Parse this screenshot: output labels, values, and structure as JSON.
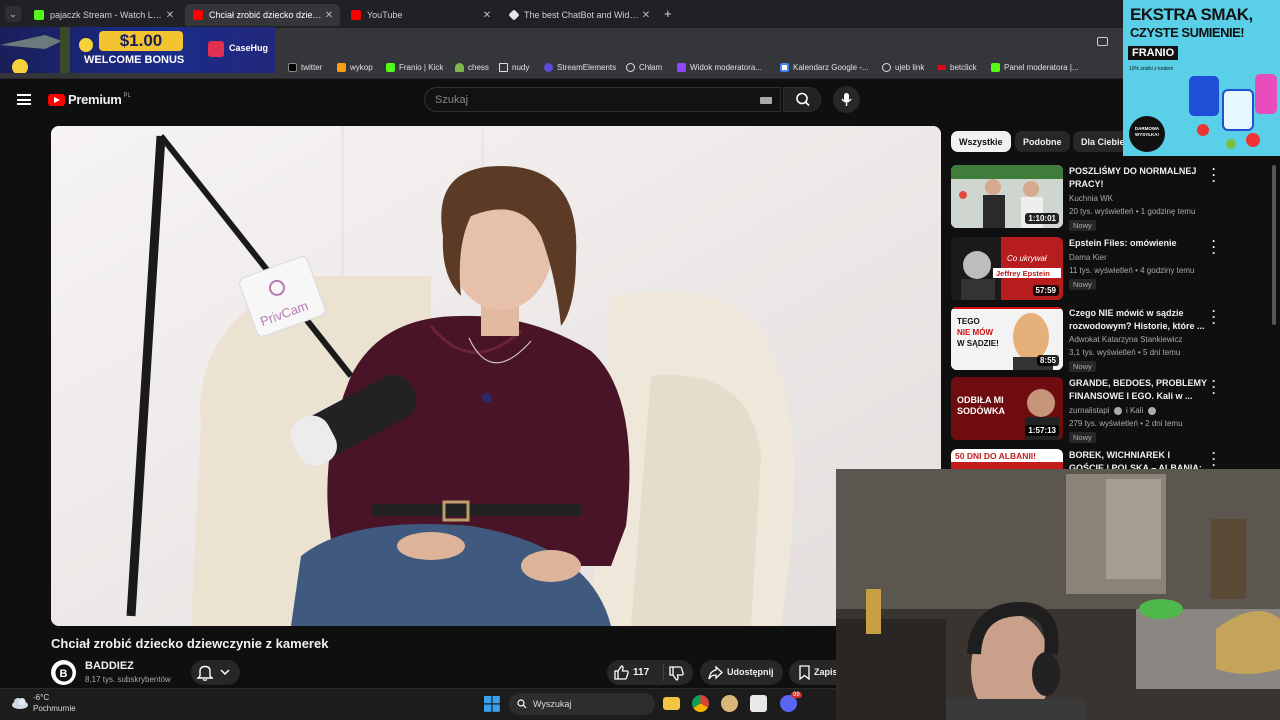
{
  "browser": {
    "tabs": [
      {
        "title": "pajaczk Stream - Watch Live on"
      },
      {
        "title": "Chciał zrobić dziecko dziewczyn"
      },
      {
        "title": "YouTube"
      },
      {
        "title": "The best ChatBot and Widgets"
      }
    ],
    "new_tab_symbol": "+"
  },
  "bookmarks": [
    {
      "label": "twitter",
      "icon": "x-icon"
    },
    {
      "label": "wykop",
      "icon": "wykop-icon"
    },
    {
      "label": "Franio | Kick",
      "icon": "kick-icon"
    },
    {
      "label": "chess",
      "icon": "chess-icon"
    },
    {
      "label": "nudy",
      "icon": "folder-icon"
    },
    {
      "label": "StreamElements",
      "icon": "streamelements-icon"
    },
    {
      "label": "Chłam",
      "icon": "globe-icon"
    },
    {
      "label": "Widok moderatora...",
      "icon": "twitch-icon"
    },
    {
      "label": "Kalendarz Google -...",
      "icon": "calendar-icon"
    },
    {
      "label": "ujeb link",
      "icon": "globe-icon"
    },
    {
      "label": "betclick",
      "icon": "betclick-icon"
    },
    {
      "label": "Panel moderatora |...",
      "icon": "kick-icon"
    }
  ],
  "youtube": {
    "logo": "Premium",
    "region": "PL",
    "search_placeholder": "Szukaj"
  },
  "video": {
    "title": "Chciał zrobić dziecko dziewczynie z kamerek",
    "channel": "BADDIEZ",
    "subscribers": "8,17 tys. subskrybentów",
    "likes": "117",
    "share_label": "Udostępnij",
    "save_label": "Zapis",
    "mic_brand": "PrivCam"
  },
  "chips": [
    "Wszystkie",
    "Podobne",
    "Dla Ciebie"
  ],
  "recommendations": [
    {
      "title": "POSZLIŚMY DO NORMALNEJ PRACY!",
      "channel": "Kuchnia WK",
      "meta": "20 tys. wyświetleń • 1 godzinę temu",
      "badge": "Nowy",
      "duration": "1:10:01",
      "thumb_color": "#3f7d3a"
    },
    {
      "title": "Epstein Files: omówienie",
      "channel": "Dama Kier",
      "meta": "11 tys. wyświetleń • 4 godziny temu",
      "badge": "Nowy",
      "duration": "57:59",
      "thumb_color": "#b81d1d",
      "thumb_text": [
        "Co ukrywał",
        "Jeffrey Epstein"
      ]
    },
    {
      "title": "Czego NIE mówić w sądzie rozwodowym? Historie, które ...",
      "channel": "Adwokat Katarzyna Stankiewicz",
      "meta": "3,1 tys. wyświetleń • 5 dni temu",
      "badge": "Nowy",
      "duration": "8:55",
      "thumb_color": "#f2f2f2",
      "thumb_text": [
        "TEGO",
        "NIE MÓW",
        "W SĄDZIE!"
      ]
    },
    {
      "title": "GRANDE, BEDOES, PROBLEMY FINANSOWE I EGO. Kali w ...",
      "channel": "zurnalistapl",
      "channel2": "i Kali",
      "meta": "279 tys. wyświetleń • 2 dni temu",
      "badge": "Nowy",
      "duration": "1:57:13",
      "thumb_color": "#7a0f12",
      "thumb_text": [
        "ODBIŁA MI",
        "SODÓWKA"
      ]
    },
    {
      "title": "BOREK, WICHNIAREK I GOŚCIE | POLSKA – ALBANIA: BARAŻE",
      "thumb_color": "#c21c1c",
      "thumb_text": [
        "50 DNI DO ALBANII!"
      ]
    }
  ],
  "ads": {
    "casehug": {
      "price": "$1.00",
      "line": "WELCOME BONUS",
      "brand": "CaseHug"
    },
    "franio": {
      "line1": "EKSTRA SMAK,",
      "line2": "CZYSTE SUMIENIE!",
      "brand": "FRANIO",
      "note": "10% zniżki z kodem",
      "badge": "DARMOWA WYSYŁKA!"
    }
  },
  "taskbar": {
    "temperature": "-6°C",
    "weather": "Pochmurnie",
    "search_placeholder": "Wyszukaj",
    "notification_count": "99"
  }
}
